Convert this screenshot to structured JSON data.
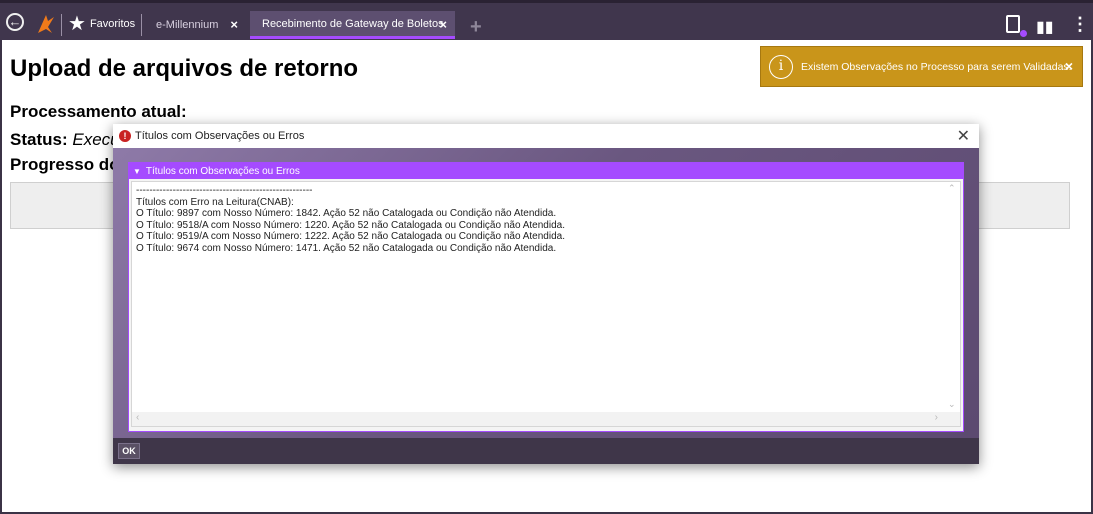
{
  "topbar": {
    "favorites_label": "Favoritos",
    "tabs": [
      {
        "label": "e-Millennium",
        "close": "×"
      },
      {
        "label": "Recebimento de Gateway de Boletos",
        "close": "×"
      }
    ],
    "add_tab": "+",
    "icons": [
      "back-icon",
      "logo-icon",
      "star-icon",
      "clipboard-icon",
      "chat-icon",
      "kebab-menu-icon"
    ],
    "accent_color": "#a54bff",
    "bar_color": "#40364d"
  },
  "page": {
    "title": "Upload de arquivos de retorno",
    "processing_label": "Processamento atual:",
    "status_label": "Status:",
    "status_value": "Execu",
    "progress_label": "Progresso do"
  },
  "notice": {
    "icon": "i",
    "text": "Existem Observações no Processo para serem Validadas.",
    "close": "×",
    "color": "#c9951a"
  },
  "dialog": {
    "title": "Títulos com Observações ou Erros",
    "close": "✕",
    "section_header": "Títulos com Observações ou Erros",
    "lines": [
      "-----------------------------------------------------",
      "Títulos com Erro na Leitura(CNAB):",
      "O Título: 9897 com Nosso Número: 1842. Ação 52 não Catalogada ou Condição não Atendida.",
      "O Título: 9518/A com Nosso Número: 1220. Ação 52 não Catalogada ou Condição não Atendida.",
      "O Título: 9519/A com Nosso Número: 1222. Ação 52 não Catalogada ou Condição não Atendida.",
      "O Título: 9674 com Nosso Número: 1471. Ação 52 não Catalogada ou Condição não Atendida."
    ],
    "ok_label": "OK"
  }
}
